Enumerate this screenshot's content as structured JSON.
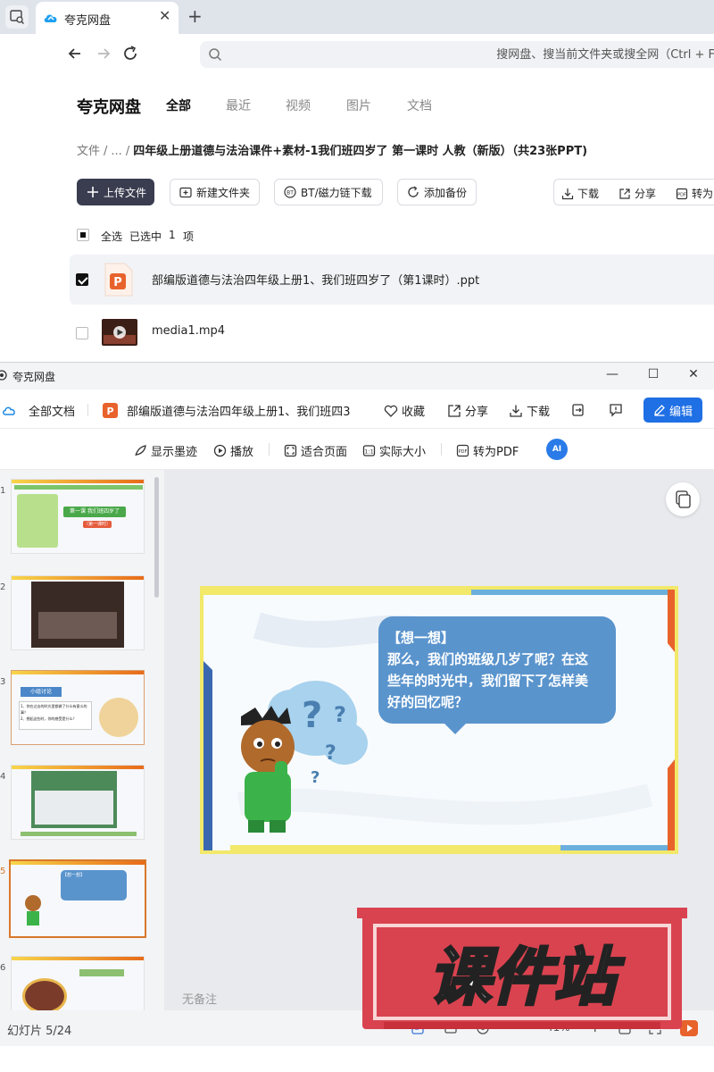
{
  "browser": {
    "tab_title": "夸克网盘",
    "search_placeholder": "搜网盘、搜当前文件夹或搜全网（Ctrl + F）"
  },
  "drive": {
    "brand": "夸克网盘",
    "nav": [
      "全部",
      "最近",
      "视频",
      "图片",
      "文档"
    ],
    "breadcrumb": {
      "root": "文件",
      "ellipsis": "...",
      "current": "四年级上册道德与法治课件+素材-1我们班四岁了 第一课时 人教（新版）（共23张PPT)"
    },
    "actions": {
      "upload": "上传文件",
      "new_folder": "新建文件夹",
      "bt": "BT/磁力链下载",
      "backup": "添加备份",
      "download": "下载",
      "share": "分享",
      "convert": "转为"
    },
    "selection": {
      "select_all": "全选",
      "selected_prefix": "已选中",
      "count": "1",
      "unit": "项"
    },
    "files": [
      {
        "name": "部编版道德与法治四年级上册1、我们班四岁了（第1课时）.ppt",
        "type": "ppt",
        "checked": true
      },
      {
        "name": "media1.mp4",
        "type": "video",
        "checked": false
      }
    ]
  },
  "viewer": {
    "window_title": "夸克网盘",
    "toolbar": {
      "all_docs": "全部文档",
      "doc_name": "部编版道德与法治四年级上册1、我们班四3",
      "favorite": "收藏",
      "share": "分享",
      "download": "下载",
      "edit": "编辑"
    },
    "subtoolbar": {
      "ink": "显示墨迹",
      "play": "播放",
      "fit": "适合页面",
      "actual": "实际大小",
      "to_pdf": "转为PDF",
      "ai": "AI"
    },
    "thumbnails": [
      {
        "no": "1",
        "caption": "第一课 我们班四岁了",
        "sub": "（第一课时）"
      },
      {
        "no": "2"
      },
      {
        "no": "3",
        "caption": "小组讨论",
        "q1": "1、你在过去的时光里都做了什么有意义的事？",
        "q2": "2、想起这些时，你的感受是什么？"
      },
      {
        "no": "4"
      },
      {
        "no": "5",
        "caption": "【想一想】"
      },
      {
        "no": "6"
      }
    ],
    "slide": {
      "line1": "【想一想】",
      "line2": "那么，我们的班级几岁了呢？在这",
      "line3": "些年的时光中，我们留下了怎样美",
      "line4": "好的回忆呢？"
    },
    "notes": "无备注",
    "status": "幻灯片 5/24",
    "zoom": "41%"
  },
  "watermark": "课件站",
  "colors": {
    "primary_button": "#3a3d4f",
    "edit_button": "#1f6fe5",
    "bubble": "#5a94cd",
    "watermark_red": "#d9434f"
  }
}
